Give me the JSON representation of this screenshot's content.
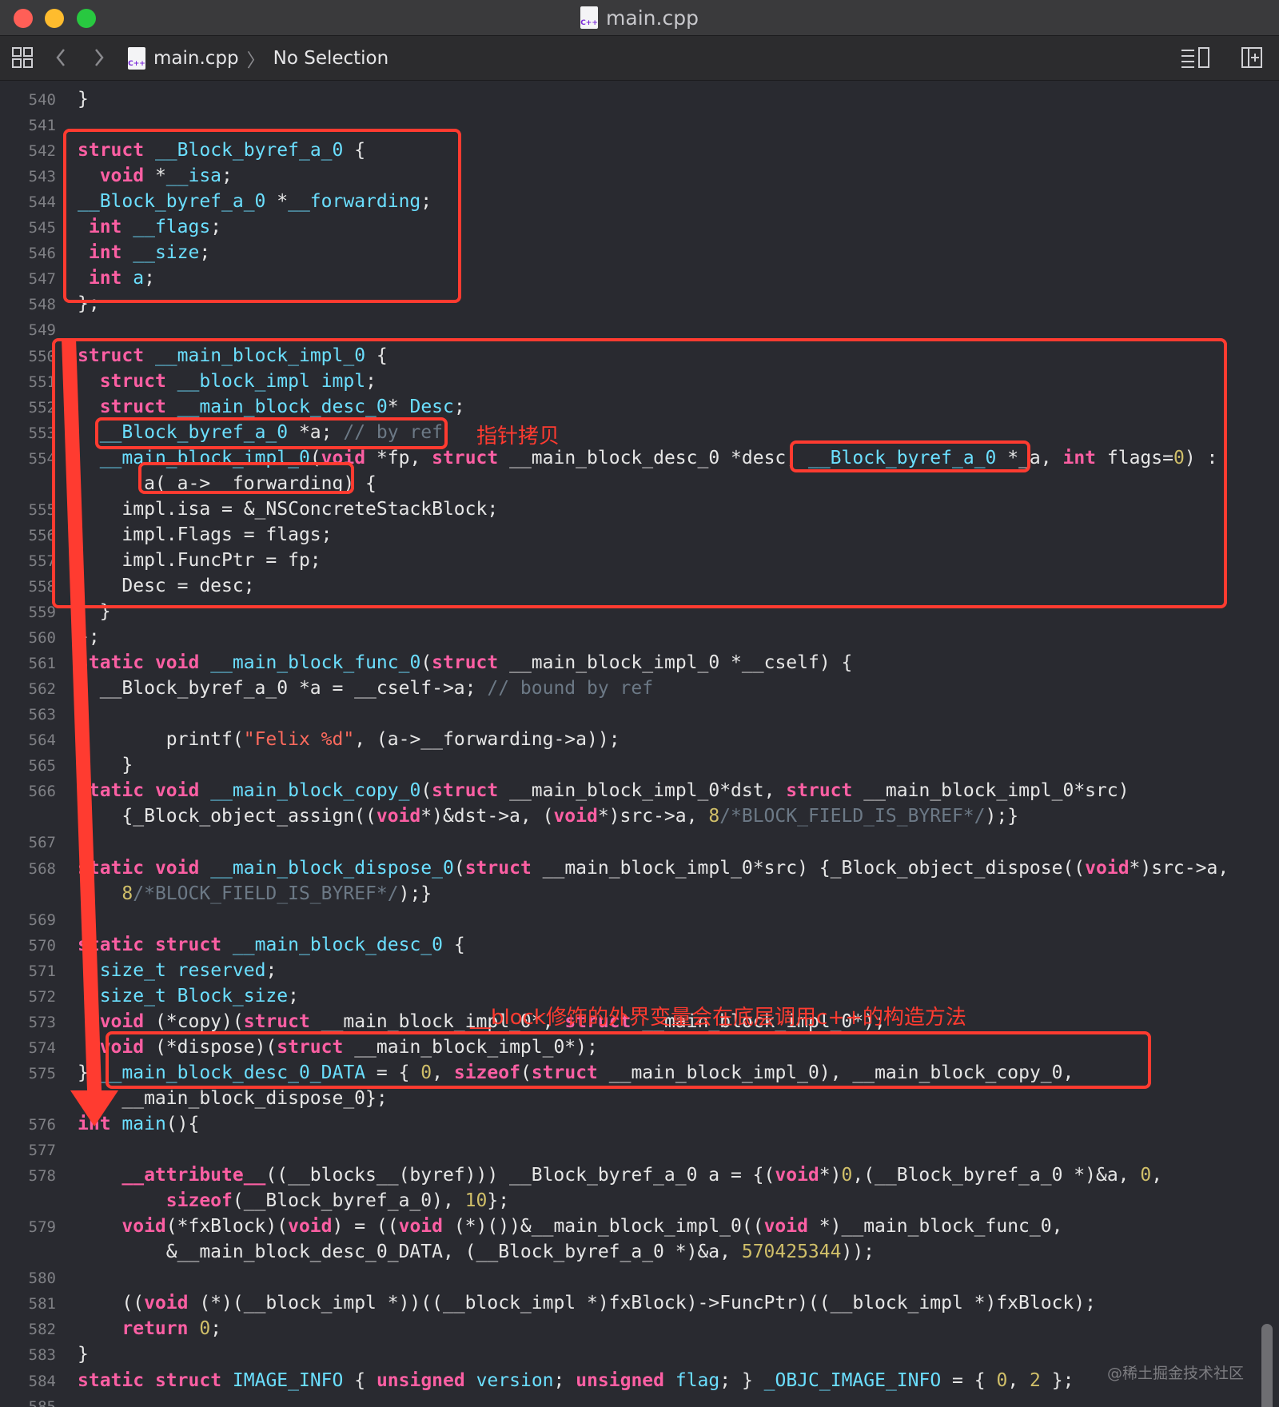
{
  "window": {
    "title": "main.cpp",
    "file_icon_text": "C++"
  },
  "jumpbar": {
    "file": "main.cpp",
    "selection": "No Selection"
  },
  "colors": {
    "keyword": "#fc5fa3",
    "type": "#6bdfff",
    "string": "#fc6a5d",
    "number": "#d0bf69",
    "comment": "#6c7986",
    "annotation": "#ff3b30",
    "background": "#292a30"
  },
  "code": {
    "lines": [
      {
        "n": "540",
        "tokens": [
          [
            "pl",
            "}"
          ]
        ]
      },
      {
        "n": "541",
        "tokens": []
      },
      {
        "n": "542",
        "tokens": [
          [
            "kw",
            "struct"
          ],
          [
            "pl",
            " "
          ],
          [
            "ty",
            "__Block_byref_a_0"
          ],
          [
            "pl",
            " {"
          ]
        ]
      },
      {
        "n": "543",
        "tokens": [
          [
            "pl",
            "  "
          ],
          [
            "kw",
            "void"
          ],
          [
            "pl",
            " *"
          ],
          [
            "ty",
            "__isa"
          ],
          [
            "pl",
            ";"
          ]
        ]
      },
      {
        "n": "544",
        "tokens": [
          [
            "ty",
            "__Block_byref_a_0"
          ],
          [
            "pl",
            " *"
          ],
          [
            "ty",
            "__forwarding"
          ],
          [
            "pl",
            ";"
          ]
        ]
      },
      {
        "n": "545",
        "tokens": [
          [
            "pl",
            " "
          ],
          [
            "kw",
            "int"
          ],
          [
            "pl",
            " "
          ],
          [
            "ty",
            "__flags"
          ],
          [
            "pl",
            ";"
          ]
        ]
      },
      {
        "n": "546",
        "tokens": [
          [
            "pl",
            " "
          ],
          [
            "kw",
            "int"
          ],
          [
            "pl",
            " "
          ],
          [
            "ty",
            "__size"
          ],
          [
            "pl",
            ";"
          ]
        ]
      },
      {
        "n": "547",
        "tokens": [
          [
            "pl",
            " "
          ],
          [
            "kw",
            "int"
          ],
          [
            "pl",
            " "
          ],
          [
            "ty",
            "a"
          ],
          [
            "pl",
            ";"
          ]
        ]
      },
      {
        "n": "548",
        "tokens": [
          [
            "pl",
            "};"
          ]
        ]
      },
      {
        "n": "549",
        "tokens": []
      },
      {
        "n": "550",
        "tokens": [
          [
            "kw",
            "struct"
          ],
          [
            "pl",
            " "
          ],
          [
            "ty",
            "__main_block_impl_0"
          ],
          [
            "pl",
            " {"
          ]
        ]
      },
      {
        "n": "551",
        "tokens": [
          [
            "pl",
            "  "
          ],
          [
            "kw",
            "struct"
          ],
          [
            "pl",
            " "
          ],
          [
            "ty",
            "__block_impl"
          ],
          [
            "pl",
            " "
          ],
          [
            "ty",
            "impl"
          ],
          [
            "pl",
            ";"
          ]
        ]
      },
      {
        "n": "552",
        "tokens": [
          [
            "pl",
            "  "
          ],
          [
            "kw",
            "struct"
          ],
          [
            "pl",
            " "
          ],
          [
            "ty",
            "__main_block_desc_0"
          ],
          [
            "pl",
            "* "
          ],
          [
            "ty",
            "Desc"
          ],
          [
            "pl",
            ";"
          ]
        ]
      },
      {
        "n": "553",
        "tokens": [
          [
            "pl",
            "  "
          ],
          [
            "ty",
            "__Block_byref_a_0"
          ],
          [
            "pl",
            " *a; "
          ],
          [
            "cmt",
            "// by ref"
          ]
        ]
      },
      {
        "n": "554",
        "tokens": [
          [
            "pl",
            "  "
          ],
          [
            "ty",
            "__main_block_impl_0"
          ],
          [
            "pl",
            "("
          ],
          [
            "kw",
            "void"
          ],
          [
            "pl",
            " *fp, "
          ],
          [
            "kw",
            "struct"
          ],
          [
            "pl",
            " __main_block_desc_0 *desc, "
          ],
          [
            "ty",
            "__Block_byref_a_0"
          ],
          [
            "pl",
            " *_a, "
          ],
          [
            "kw",
            "int"
          ],
          [
            "pl",
            " flags="
          ],
          [
            "num",
            "0"
          ],
          [
            "pl",
            ") :"
          ]
        ]
      },
      {
        "n": "",
        "tokens": [
          [
            "pl",
            "      a(_a->__forwarding) {"
          ]
        ]
      },
      {
        "n": "555",
        "tokens": [
          [
            "pl",
            "    impl.isa = &_NSConcreteStackBlock;"
          ]
        ]
      },
      {
        "n": "556",
        "tokens": [
          [
            "pl",
            "    impl.Flags = flags;"
          ]
        ]
      },
      {
        "n": "557",
        "tokens": [
          [
            "pl",
            "    impl.FuncPtr = fp;"
          ]
        ]
      },
      {
        "n": "558",
        "tokens": [
          [
            "pl",
            "    Desc = desc;"
          ]
        ]
      },
      {
        "n": "559",
        "tokens": [
          [
            "pl",
            "  }"
          ]
        ]
      },
      {
        "n": "560",
        "tokens": [
          [
            "pl",
            "};"
          ]
        ]
      },
      {
        "n": "561",
        "tokens": [
          [
            "kw",
            "static"
          ],
          [
            "pl",
            " "
          ],
          [
            "kw",
            "void"
          ],
          [
            "pl",
            " "
          ],
          [
            "ty",
            "__main_block_func_0"
          ],
          [
            "pl",
            "("
          ],
          [
            "kw",
            "struct"
          ],
          [
            "pl",
            " __main_block_impl_0 *__cself) {"
          ]
        ]
      },
      {
        "n": "562",
        "tokens": [
          [
            "pl",
            "  __Block_byref_a_0 *a = __cself->a; "
          ],
          [
            "cmt",
            "// bound by ref"
          ]
        ]
      },
      {
        "n": "563",
        "tokens": []
      },
      {
        "n": "564",
        "tokens": [
          [
            "pl",
            "        printf("
          ],
          [
            "str",
            "\"Felix %d\""
          ],
          [
            "pl",
            ", (a->__forwarding->a));"
          ]
        ]
      },
      {
        "n": "565",
        "tokens": [
          [
            "pl",
            "    }"
          ]
        ]
      },
      {
        "n": "566",
        "tokens": [
          [
            "kw",
            "static"
          ],
          [
            "pl",
            " "
          ],
          [
            "kw",
            "void"
          ],
          [
            "pl",
            " "
          ],
          [
            "ty",
            "__main_block_copy_0"
          ],
          [
            "pl",
            "("
          ],
          [
            "kw",
            "struct"
          ],
          [
            "pl",
            " __main_block_impl_0*dst, "
          ],
          [
            "kw",
            "struct"
          ],
          [
            "pl",
            " __main_block_impl_0*src)"
          ]
        ]
      },
      {
        "n": "",
        "tokens": [
          [
            "pl",
            "    {_Block_object_assign(("
          ],
          [
            "kw",
            "void"
          ],
          [
            "pl",
            "*)&dst->a, ("
          ],
          [
            "kw",
            "void"
          ],
          [
            "pl",
            "*)src->a, "
          ],
          [
            "num",
            "8"
          ],
          [
            "cmt",
            "/*BLOCK_FIELD_IS_BYREF*/"
          ],
          [
            "pl",
            ");}"
          ]
        ]
      },
      {
        "n": "567",
        "tokens": []
      },
      {
        "n": "568",
        "tokens": [
          [
            "kw",
            "static"
          ],
          [
            "pl",
            " "
          ],
          [
            "kw",
            "void"
          ],
          [
            "pl",
            " "
          ],
          [
            "ty",
            "__main_block_dispose_0"
          ],
          [
            "pl",
            "("
          ],
          [
            "kw",
            "struct"
          ],
          [
            "pl",
            " __main_block_impl_0*src) {_Block_object_dispose(("
          ],
          [
            "kw",
            "void"
          ],
          [
            "pl",
            "*)src->a,"
          ]
        ]
      },
      {
        "n": "",
        "tokens": [
          [
            "pl",
            "    "
          ],
          [
            "num",
            "8"
          ],
          [
            "cmt",
            "/*BLOCK_FIELD_IS_BYREF*/"
          ],
          [
            "pl",
            ");}"
          ]
        ]
      },
      {
        "n": "569",
        "tokens": []
      },
      {
        "n": "570",
        "tokens": [
          [
            "kw",
            "static"
          ],
          [
            "pl",
            " "
          ],
          [
            "kw",
            "struct"
          ],
          [
            "pl",
            " "
          ],
          [
            "ty",
            "__main_block_desc_0"
          ],
          [
            "pl",
            " {"
          ]
        ]
      },
      {
        "n": "571",
        "tokens": [
          [
            "pl",
            "  "
          ],
          [
            "ty",
            "size_t"
          ],
          [
            "pl",
            " "
          ],
          [
            "ty",
            "reserved"
          ],
          [
            "pl",
            ";"
          ]
        ]
      },
      {
        "n": "572",
        "tokens": [
          [
            "pl",
            "  "
          ],
          [
            "ty",
            "size_t"
          ],
          [
            "pl",
            " "
          ],
          [
            "ty",
            "Block_size"
          ],
          [
            "pl",
            ";"
          ]
        ]
      },
      {
        "n": "573",
        "tokens": [
          [
            "pl",
            "  "
          ],
          [
            "kw",
            "void"
          ],
          [
            "pl",
            " (*copy)("
          ],
          [
            "kw",
            "struct"
          ],
          [
            "pl",
            " __main_block_impl_0*, "
          ],
          [
            "kw",
            "struct"
          ],
          [
            "pl",
            " __main_block_impl_0*);"
          ]
        ]
      },
      {
        "n": "574",
        "tokens": [
          [
            "pl",
            "  "
          ],
          [
            "kw",
            "void"
          ],
          [
            "pl",
            " (*dispose)("
          ],
          [
            "kw",
            "struct"
          ],
          [
            "pl",
            " __main_block_impl_0*);"
          ]
        ]
      },
      {
        "n": "575",
        "tokens": [
          [
            "pl",
            "} "
          ],
          [
            "ty",
            "__main_block_desc_0_DATA"
          ],
          [
            "pl",
            " = { "
          ],
          [
            "num",
            "0"
          ],
          [
            "pl",
            ", "
          ],
          [
            "kw",
            "sizeof"
          ],
          [
            "pl",
            "("
          ],
          [
            "kw",
            "struct"
          ],
          [
            "pl",
            " __main_block_impl_0), __main_block_copy_0,"
          ]
        ]
      },
      {
        "n": "",
        "tokens": [
          [
            "pl",
            "    __main_block_dispose_0};"
          ]
        ]
      },
      {
        "n": "576",
        "tokens": [
          [
            "kw",
            "int"
          ],
          [
            "pl",
            " "
          ],
          [
            "ty",
            "main"
          ],
          [
            "pl",
            "(){"
          ]
        ]
      },
      {
        "n": "577",
        "tokens": []
      },
      {
        "n": "578",
        "tokens": [
          [
            "pl",
            "    "
          ],
          [
            "kw",
            "__attribute__"
          ],
          [
            "pl",
            "((__blocks__(byref))) __Block_byref_a_0 a = {("
          ],
          [
            "kw",
            "void"
          ],
          [
            "pl",
            "*)"
          ],
          [
            "num",
            "0"
          ],
          [
            "pl",
            ",(__Block_byref_a_0 *)&a, "
          ],
          [
            "num",
            "0"
          ],
          [
            "pl",
            ","
          ]
        ]
      },
      {
        "n": "",
        "tokens": [
          [
            "pl",
            "        "
          ],
          [
            "kw",
            "sizeof"
          ],
          [
            "pl",
            "(__Block_byref_a_0), "
          ],
          [
            "num",
            "10"
          ],
          [
            "pl",
            "};"
          ]
        ]
      },
      {
        "n": "579",
        "tokens": [
          [
            "pl",
            "    "
          ],
          [
            "kw",
            "void"
          ],
          [
            "pl",
            "(*fxBlock)("
          ],
          [
            "kw",
            "void"
          ],
          [
            "pl",
            ") = (("
          ],
          [
            "kw",
            "void"
          ],
          [
            "pl",
            " (*)())&__main_block_impl_0(("
          ],
          [
            "kw",
            "void"
          ],
          [
            "pl",
            " *)__main_block_func_0,"
          ]
        ]
      },
      {
        "n": "",
        "tokens": [
          [
            "pl",
            "        &__main_block_desc_0_DATA, (__Block_byref_a_0 *)&a, "
          ],
          [
            "num",
            "570425344"
          ],
          [
            "pl",
            "));"
          ]
        ]
      },
      {
        "n": "580",
        "tokens": []
      },
      {
        "n": "581",
        "tokens": [
          [
            "pl",
            "    (("
          ],
          [
            "kw",
            "void"
          ],
          [
            "pl",
            " (*)(__block_impl *))((__block_impl *)fxBlock)->FuncPtr)((__block_impl *)fxBlock);"
          ]
        ]
      },
      {
        "n": "582",
        "tokens": [
          [
            "pl",
            "    "
          ],
          [
            "kw",
            "return"
          ],
          [
            "pl",
            " "
          ],
          [
            "num",
            "0"
          ],
          [
            "pl",
            ";"
          ]
        ]
      },
      {
        "n": "583",
        "tokens": [
          [
            "pl",
            "}"
          ]
        ]
      },
      {
        "n": "584",
        "tokens": [
          [
            "kw",
            "static"
          ],
          [
            "pl",
            " "
          ],
          [
            "kw",
            "struct"
          ],
          [
            "pl",
            " "
          ],
          [
            "ty",
            "IMAGE_INFO"
          ],
          [
            "pl",
            " { "
          ],
          [
            "kw",
            "unsigned"
          ],
          [
            "pl",
            " "
          ],
          [
            "ty",
            "version"
          ],
          [
            "pl",
            "; "
          ],
          [
            "kw",
            "unsigned"
          ],
          [
            "pl",
            " "
          ],
          [
            "ty",
            "flag"
          ],
          [
            "pl",
            "; } "
          ],
          [
            "ty",
            "_OBJC_IMAGE_INFO"
          ],
          [
            "pl",
            " = { "
          ],
          [
            "num",
            "0"
          ],
          [
            "pl",
            ", "
          ],
          [
            "num",
            "2"
          ],
          [
            "pl",
            " };"
          ]
        ]
      },
      {
        "n": "585",
        "tokens": []
      }
    ]
  },
  "annotations": {
    "pointer_copy": "指针拷贝",
    "constructor_note": "__block修饰的外界变量会在底层调用c++的构造方法"
  },
  "watermark": "@稀土掘金技术社区"
}
